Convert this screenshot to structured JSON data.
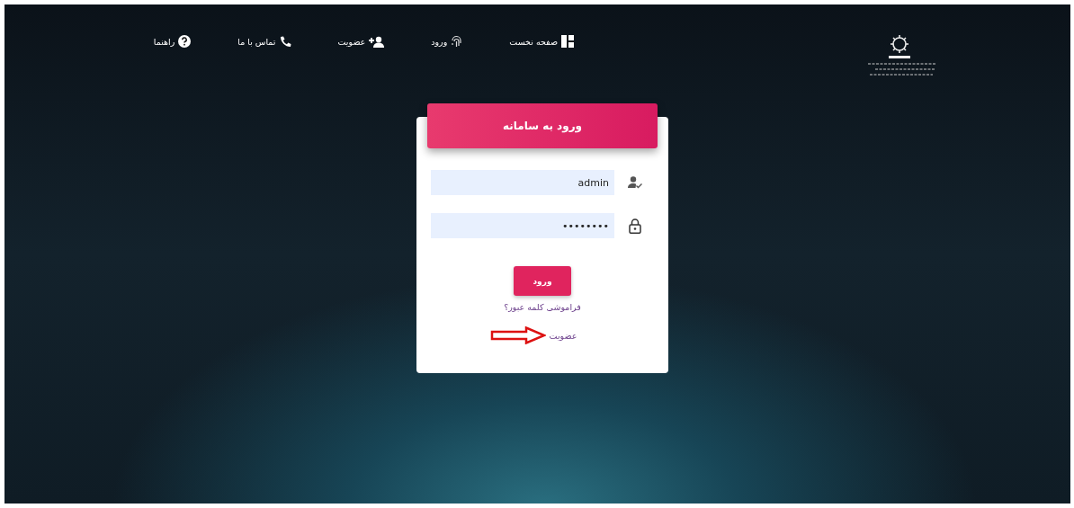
{
  "nav": {
    "items": [
      {
        "label": "صفحه نخست"
      },
      {
        "label": "ورود"
      },
      {
        "label": "عضویت"
      },
      {
        "label": "تماس با ما"
      },
      {
        "label": "راهنما"
      }
    ]
  },
  "login": {
    "title": "ورود به سامانه",
    "fields": [
      {
        "kind": "text",
        "value": "admin"
      },
      {
        "kind": "password",
        "value": "••••••••"
      }
    ],
    "submit": "ورود",
    "forgot_link": "فراموشی کلمه عبور؟",
    "signup_link": "عضویت"
  }
}
